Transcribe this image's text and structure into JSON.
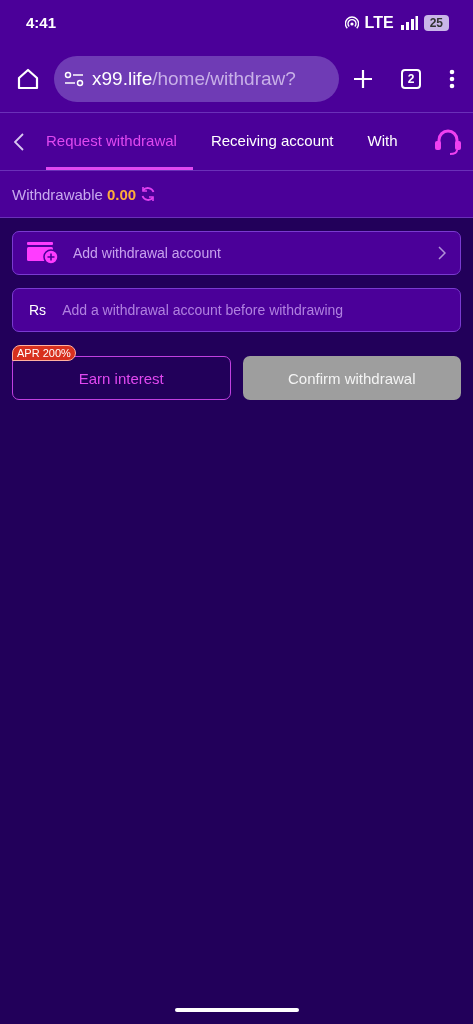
{
  "status_bar": {
    "time": "4:41",
    "network": "LTE",
    "battery": "25"
  },
  "browser": {
    "url_host": "x99.life",
    "url_path": "/home/withdraw?",
    "tab_count": "2"
  },
  "tabs": [
    {
      "label": "Request withdrawal",
      "selected": true
    },
    {
      "label": "Receiving account",
      "selected": false
    },
    {
      "label": "With",
      "selected": false
    }
  ],
  "balance": {
    "label": "Withdrawable",
    "amount": "0.00"
  },
  "account_row": {
    "label": "Add withdrawal account"
  },
  "amount_field": {
    "currency": "Rs",
    "placeholder": "Add a withdrawal account before withdrawing"
  },
  "buttons": [
    {
      "label": "Earn interest",
      "badge": "APR 200%",
      "kind": "outline",
      "disabled": false
    },
    {
      "label": "Confirm withdrawal",
      "kind": "solid",
      "disabled": true
    }
  ]
}
